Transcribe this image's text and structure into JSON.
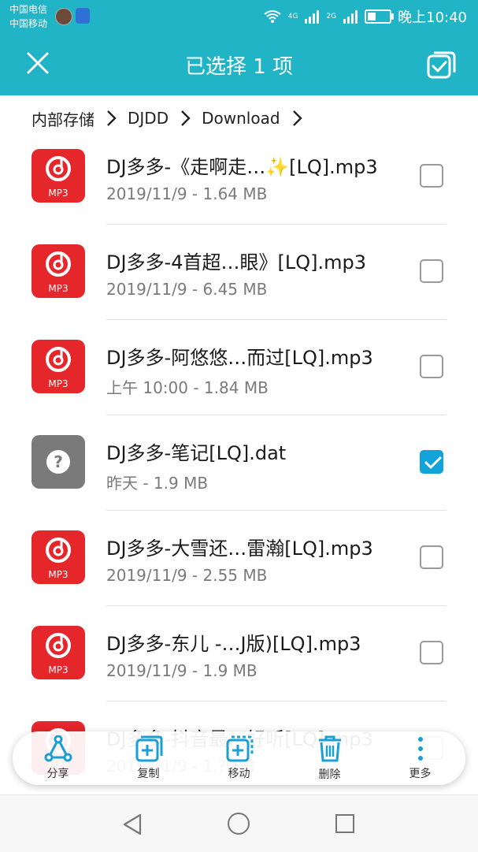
{
  "status_bar": {
    "carrier_1": "中国电信",
    "carrier_2": "中国移动",
    "network_1": "4G",
    "network_2": "2G",
    "time": "晚上10:40"
  },
  "header": {
    "title": "已选择 1 项",
    "close_icon": "close-icon",
    "select_all_icon": "select-all-icon"
  },
  "breadcrumb": [
    "内部存储",
    "DJDD",
    "Download"
  ],
  "files": [
    {
      "name": "DJ多多-《走啊走…✨[LQ].mp3",
      "meta": "2019/11/9 - 1.64 MB",
      "type": "mp3",
      "checked": false
    },
    {
      "name": "DJ多多-4首超…眼》[LQ].mp3",
      "meta": "2019/11/9 - 6.45 MB",
      "type": "mp3",
      "checked": false
    },
    {
      "name": "DJ多多-阿悠悠…而过[LQ].mp3",
      "meta": "上午 10:00 - 1.84 MB",
      "type": "mp3",
      "checked": false
    },
    {
      "name": "DJ多多-笔记[LQ].dat",
      "meta": "昨天 - 1.9 MB",
      "type": "unknown",
      "checked": true
    },
    {
      "name": "DJ多多-大雪还…雷瀚[LQ].mp3",
      "meta": "2019/11/9 - 2.55 MB",
      "type": "mp3",
      "checked": false
    },
    {
      "name": "DJ多多-东儿 -…J版)[LQ].mp3",
      "meta": "2019/11/9 - 1.9 MB",
      "type": "mp3",
      "checked": false
    },
    {
      "name": "DJ多多-抖音最…好听[LQ].mp3",
      "meta": "2019/11/9 - 1.? MB",
      "type": "mp3",
      "checked": false
    }
  ],
  "file_type_label": "MP3",
  "actions": [
    {
      "label": "分享",
      "icon": "share-icon"
    },
    {
      "label": "复制",
      "icon": "copy-icon"
    },
    {
      "label": "移动",
      "icon": "move-icon"
    },
    {
      "label": "删除",
      "icon": "trash-icon"
    },
    {
      "label": "更多",
      "icon": "more-vertical-icon"
    }
  ],
  "colors": {
    "accent": "#21b3c6",
    "checkbox_on": "#11a3d9",
    "mp3_icon": "#e5262a",
    "unknown_icon": "#7a7a7a"
  }
}
